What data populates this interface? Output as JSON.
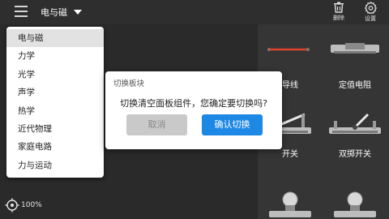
{
  "topbar": {
    "category": "电与磁",
    "delete_label": "删除",
    "settings_label": "设置"
  },
  "dropdown": {
    "items": [
      "电与磁",
      "力学",
      "光学",
      "声学",
      "热学",
      "近代物理",
      "家庭电路",
      "力与运动"
    ],
    "selected": "电与磁"
  },
  "dialog": {
    "title": "切换板块",
    "message": "切换清空面板组件，您确定要切换吗?",
    "cancel_label": "取消",
    "ok_label": "确认切换"
  },
  "components": [
    "导线",
    "定值电阻",
    "开关",
    "双掷开关"
  ],
  "zoom": {
    "value": "100%"
  },
  "colors": {
    "accent": "#1e88e5",
    "background": "#2e2e2e"
  }
}
